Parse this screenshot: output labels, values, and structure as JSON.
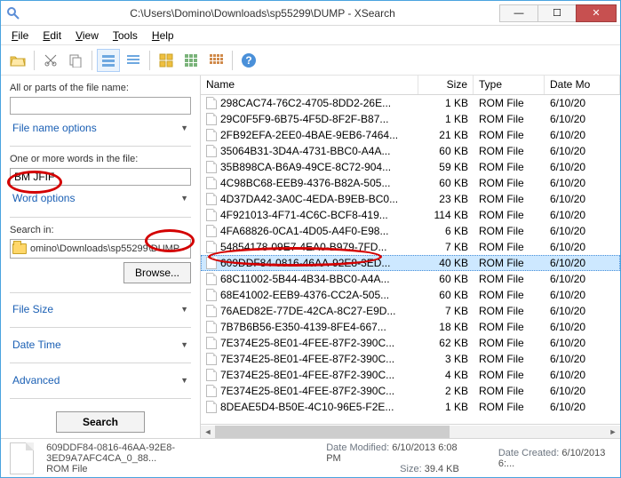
{
  "window": {
    "title": "C:\\Users\\Domino\\Downloads\\sp55299\\DUMP - XSearch"
  },
  "menu": {
    "file": "File",
    "edit": "Edit",
    "view": "View",
    "tools": "Tools",
    "help": "Help"
  },
  "left": {
    "name_label": "All or parts of the file name:",
    "name_value": "",
    "file_name_options": "File name options",
    "words_label": "One or more words in the file:",
    "words_value": "BM JFIF",
    "word_options": "Word options",
    "search_in_label": "Search in:",
    "path_display": "omino\\Downloads\\sp55299\\DUMP",
    "browse": "Browse...",
    "file_size": "File Size",
    "date_time": "Date Time",
    "advanced": "Advanced",
    "search": "Search"
  },
  "columns": {
    "name": "Name",
    "size": "Size",
    "type": "Type",
    "date": "Date Mo"
  },
  "rows": [
    {
      "name": "298CAC74-76C2-4705-8DD2-26E...",
      "size": "1 KB",
      "type": "ROM File",
      "date": "6/10/20"
    },
    {
      "name": "29C0F5F9-6B75-4F5D-8F2F-B87...",
      "size": "1 KB",
      "type": "ROM File",
      "date": "6/10/20"
    },
    {
      "name": "2FB92EFA-2EE0-4BAE-9EB6-7464...",
      "size": "21 KB",
      "type": "ROM File",
      "date": "6/10/20"
    },
    {
      "name": "35064B31-3D4A-4731-BBC0-A4A...",
      "size": "60 KB",
      "type": "ROM File",
      "date": "6/10/20"
    },
    {
      "name": "35B898CA-B6A9-49CE-8C72-904...",
      "size": "59 KB",
      "type": "ROM File",
      "date": "6/10/20"
    },
    {
      "name": "4C98BC68-EEB9-4376-B82A-505...",
      "size": "60 KB",
      "type": "ROM File",
      "date": "6/10/20"
    },
    {
      "name": "4D37DA42-3A0C-4EDA-B9EB-BC0...",
      "size": "23 KB",
      "type": "ROM File",
      "date": "6/10/20"
    },
    {
      "name": "4F921013-4F71-4C6C-BCF8-419...",
      "size": "114 KB",
      "type": "ROM File",
      "date": "6/10/20"
    },
    {
      "name": "4FA68826-0CA1-4D05-A4F0-E98...",
      "size": "6 KB",
      "type": "ROM File",
      "date": "6/10/20"
    },
    {
      "name": "54854178-09E7-4EA0-B979-7FD...",
      "size": "7 KB",
      "type": "ROM File",
      "date": "6/10/20"
    },
    {
      "name": "609DDF84-0816-46AA-92E8-3ED...",
      "size": "40 KB",
      "type": "ROM File",
      "date": "6/10/20",
      "selected": true
    },
    {
      "name": "68C11002-5B44-4B34-BBC0-A4A...",
      "size": "60 KB",
      "type": "ROM File",
      "date": "6/10/20"
    },
    {
      "name": "68E41002-EEB9-4376-CC2A-505...",
      "size": "60 KB",
      "type": "ROM File",
      "date": "6/10/20"
    },
    {
      "name": "76AED82E-77DE-42CA-8C27-E9D...",
      "size": "7 KB",
      "type": "ROM File",
      "date": "6/10/20"
    },
    {
      "name": "7B7B6B56-E350-4139-8FE4-667...",
      "size": "18 KB",
      "type": "ROM File",
      "date": "6/10/20"
    },
    {
      "name": "7E374E25-8E01-4FEE-87F2-390C...",
      "size": "62 KB",
      "type": "ROM File",
      "date": "6/10/20"
    },
    {
      "name": "7E374E25-8E01-4FEE-87F2-390C...",
      "size": "3 KB",
      "type": "ROM File",
      "date": "6/10/20"
    },
    {
      "name": "7E374E25-8E01-4FEE-87F2-390C...",
      "size": "4 KB",
      "type": "ROM File",
      "date": "6/10/20"
    },
    {
      "name": "7E374E25-8E01-4FEE-87F2-390C...",
      "size": "2 KB",
      "type": "ROM File",
      "date": "6/10/20"
    },
    {
      "name": "8DEAE5D4-B50E-4C10-96E5-F2E...",
      "size": "1 KB",
      "type": "ROM File",
      "date": "6/10/20"
    }
  ],
  "status": {
    "file_name": "609DDF84-0816-46AA-92E8-3ED9A7AFC4CA_0_88...",
    "file_type": "ROM File",
    "modified_label": "Date Modified:",
    "modified_value": "6/10/2013 6:08 PM",
    "size_label": "Size:",
    "size_value": "39.4 KB",
    "created_label": "Date Created:",
    "created_value": "6/10/2013 6:..."
  }
}
